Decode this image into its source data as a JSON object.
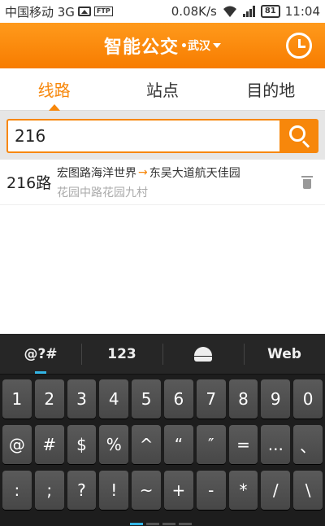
{
  "statusbar": {
    "carrier": "中国移动 3G",
    "ftp_label": "FTP",
    "speed": "0.08K/s",
    "battery": "81",
    "time": "11:04"
  },
  "header": {
    "title": "智能公交",
    "city": "•武汉"
  },
  "tabs": [
    {
      "label": "线路"
    },
    {
      "label": "站点"
    },
    {
      "label": "目的地"
    }
  ],
  "search": {
    "value": "216"
  },
  "results": [
    {
      "route": "216路",
      "from": "宏图路海洋世界",
      "to": "东吴大道航天佳园",
      "arrow": "→",
      "sub": "花园中路花园九村"
    }
  ],
  "keyboard": {
    "modes": [
      "@?#",
      "123",
      "",
      "Web"
    ],
    "row1": [
      "1",
      "2",
      "3",
      "4",
      "5",
      "6",
      "7",
      "8",
      "9",
      "0"
    ],
    "row2": [
      "@",
      "#",
      "$",
      "%",
      "^",
      "“",
      "″",
      "=",
      "...",
      "、"
    ],
    "row3": [
      ":",
      ";",
      "?",
      "!",
      "~",
      "+",
      "-",
      "*",
      "/",
      "\\"
    ]
  },
  "colors": {
    "accent": "#f7870b",
    "keyboard_highlight": "#33b5e5"
  }
}
